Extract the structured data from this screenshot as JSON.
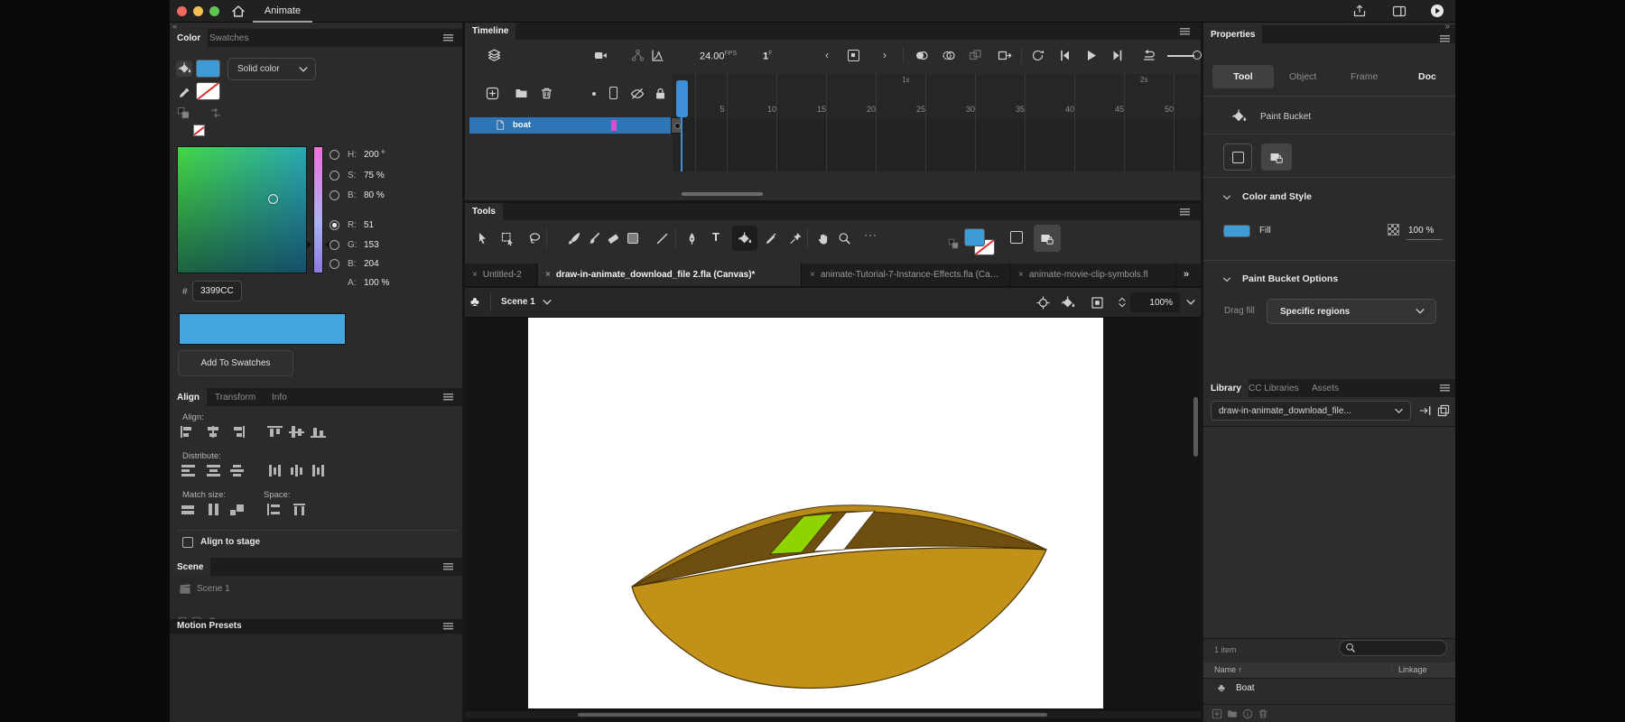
{
  "titlebar": {
    "app_tab": "Animate"
  },
  "misc": {
    "collapse": "«",
    "overflow": "»",
    "more": "···",
    "sort_arrow": "↑"
  },
  "color": {
    "tabs": [
      "Color",
      "Swatches"
    ],
    "fill_type": "Solid color",
    "rows": [
      {
        "l": "H:",
        "v": "200 °"
      },
      {
        "l": "S:",
        "v": "75 %"
      },
      {
        "l": "B:",
        "v": "80 %"
      },
      {
        "l": "R:",
        "v": "51"
      },
      {
        "l": "G:",
        "v": "153"
      },
      {
        "l": "B:",
        "v": "204"
      },
      {
        "l": "A:",
        "v": "100 %"
      }
    ],
    "hash": "#",
    "hex": "3399CC",
    "add_button": "Add To Swatches"
  },
  "alignp": {
    "tabs": [
      "Align",
      "Transform",
      "Info"
    ],
    "align_label": "Align:",
    "distribute_label": "Distribute:",
    "match_label": "Match size:",
    "space_label": "Space:",
    "checkbox_label": "Align to stage"
  },
  "scenep": {
    "title": "Scene",
    "item": "Scene 1"
  },
  "motionp": {
    "title": "Motion Presets"
  },
  "tl": {
    "title": "Timeline",
    "fps": "24.00",
    "fps_unit": "FPS",
    "frame": "1",
    "frame_unit": "F",
    "layer": "boat",
    "sec": [
      "1s",
      "2s"
    ],
    "ruler": [
      "5",
      "10",
      "15",
      "20",
      "25",
      "30",
      "35",
      "40",
      "45",
      "50"
    ]
  },
  "toolsp": {
    "title": "Tools"
  },
  "tabs": {
    "close": "×",
    "items": [
      {
        "label": "Untitled-2"
      },
      {
        "label": "draw-in-animate_download_file 2.fla (Canvas)*"
      },
      {
        "label": "animate-Tutorial-7-Instance-Effects.fla (Canvas)"
      },
      {
        "label": "animate-movie-clip-symbols.fl"
      }
    ]
  },
  "editbar": {
    "scene": "Scene 1",
    "zoom": "100%"
  },
  "props": {
    "title": "Properties",
    "tabs": [
      "Tool",
      "Object",
      "Frame",
      "Doc"
    ],
    "tool_name": "Paint Bucket",
    "color_style": "Color and Style",
    "fill_label": "Fill",
    "fill_alpha": "100 %",
    "pbo": "Paint Bucket Options",
    "drag_label": "Drag fill",
    "drag_value": "Specific regions"
  },
  "lib": {
    "tabs": [
      "Library",
      "CC Libraries",
      "Assets"
    ],
    "doc": "draw-in-animate_download_file...",
    "count": "1 item",
    "col_name": "Name",
    "col_linkage": "Linkage",
    "item": "Boat"
  },
  "colors": {
    "fill_hex_value": "#3399CC",
    "swatch_blue": "#3E9BD6",
    "preview_blue": "#45A5DE",
    "selection_blue": "#2E75B6",
    "playhead_blue": "#3E8FD6",
    "keyframe_magenta": "#D94FD0",
    "boat_hull": "#C29118",
    "boat_rim": "#B8891B",
    "boat_interior": "#6E4F10",
    "boat_green": "#8FD400",
    "boat_white": "#FFFFFF"
  }
}
